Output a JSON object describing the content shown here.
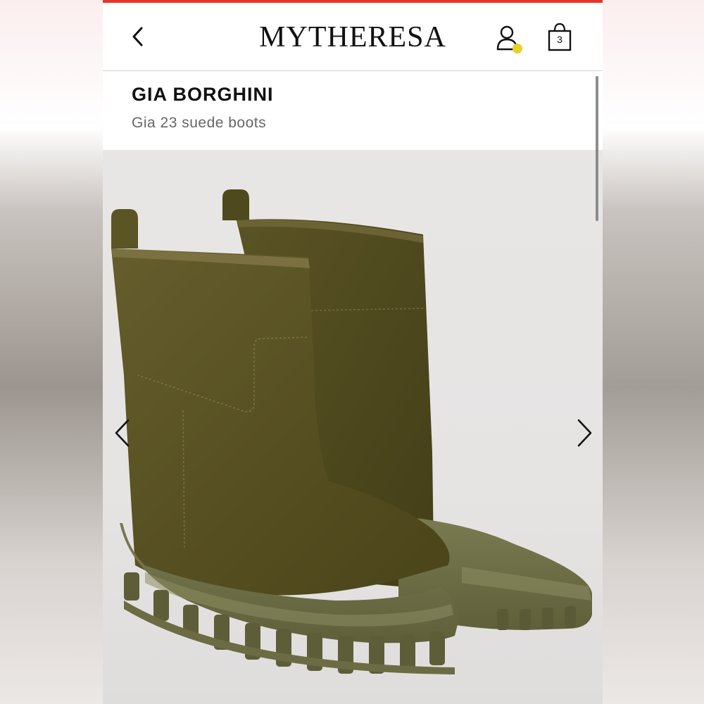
{
  "header": {
    "logo_text": "MYTHERESA",
    "cart_count": "3",
    "accent_color": "#e5352b",
    "notification_dot_color": "#e3d32a",
    "icons": [
      "chevron-left-icon",
      "user-icon",
      "shopping-bag-icon"
    ]
  },
  "product": {
    "brand": "GIA BORGHINI",
    "name": "Gia 23 suede boots"
  },
  "gallery": {
    "icons": [
      "chevron-left-icon",
      "chevron-right-icon"
    ],
    "boot_color": "#5a5425",
    "sole_color": "#6f7046"
  }
}
